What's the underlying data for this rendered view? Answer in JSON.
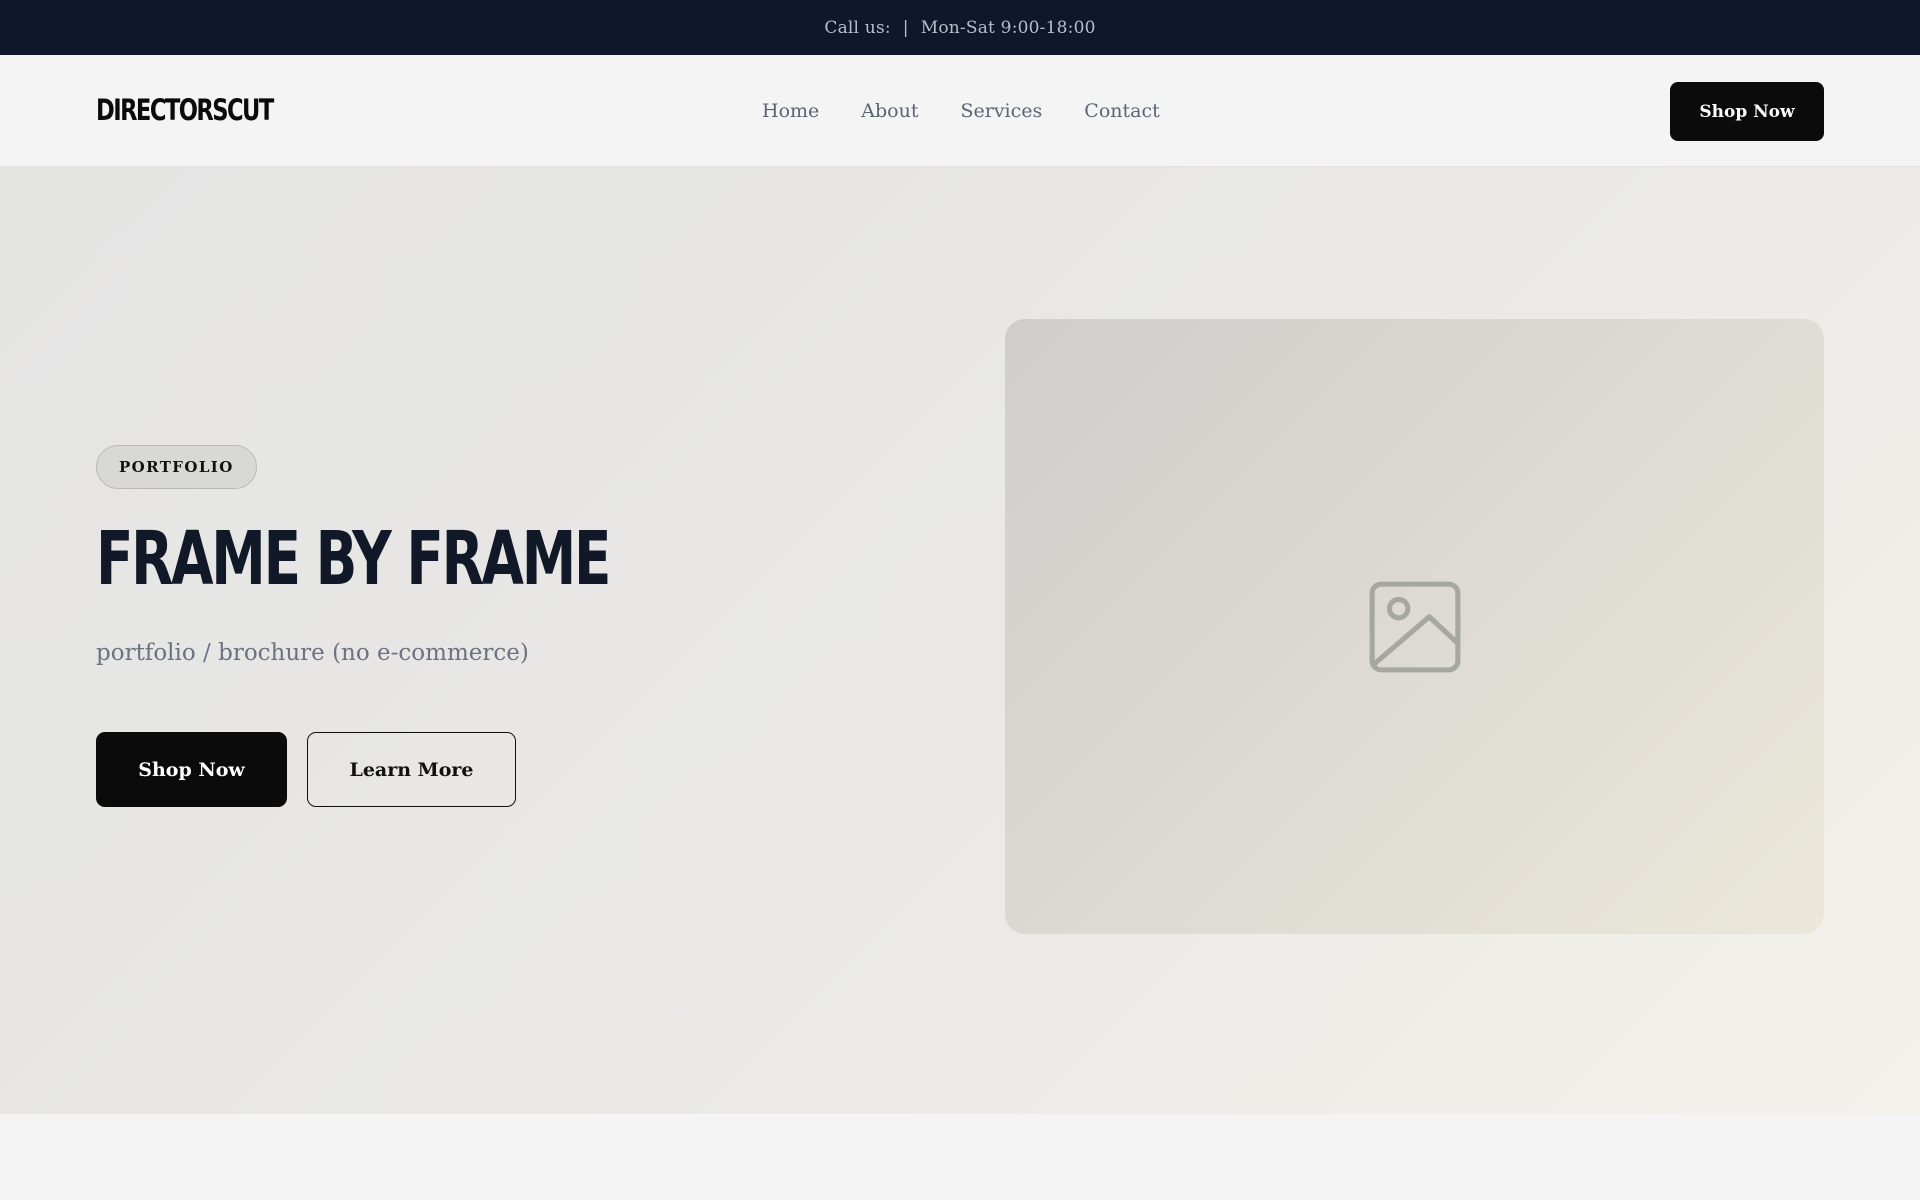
{
  "topbar": {
    "call_label": "Call us:",
    "separator": "|",
    "hours": "Mon-Sat 9:00-18:00"
  },
  "navbar": {
    "logo": "DIRECTORSCUT",
    "links": [
      "Home",
      "About",
      "Services",
      "Contact"
    ],
    "cta_label": "Shop Now"
  },
  "hero": {
    "badge": "PORTFOLIO",
    "title": "FRAME BY FRAME",
    "subtitle": "portfolio / brochure (no e-commerce)",
    "primary_button": "Shop Now",
    "secondary_button": "Learn More",
    "media_icon": "image-placeholder-icon"
  },
  "colors": {
    "topbar_bg": "#0f172a",
    "button_bg": "#0b0b0b",
    "title_color": "#111827",
    "muted_text": "#6b7280"
  }
}
